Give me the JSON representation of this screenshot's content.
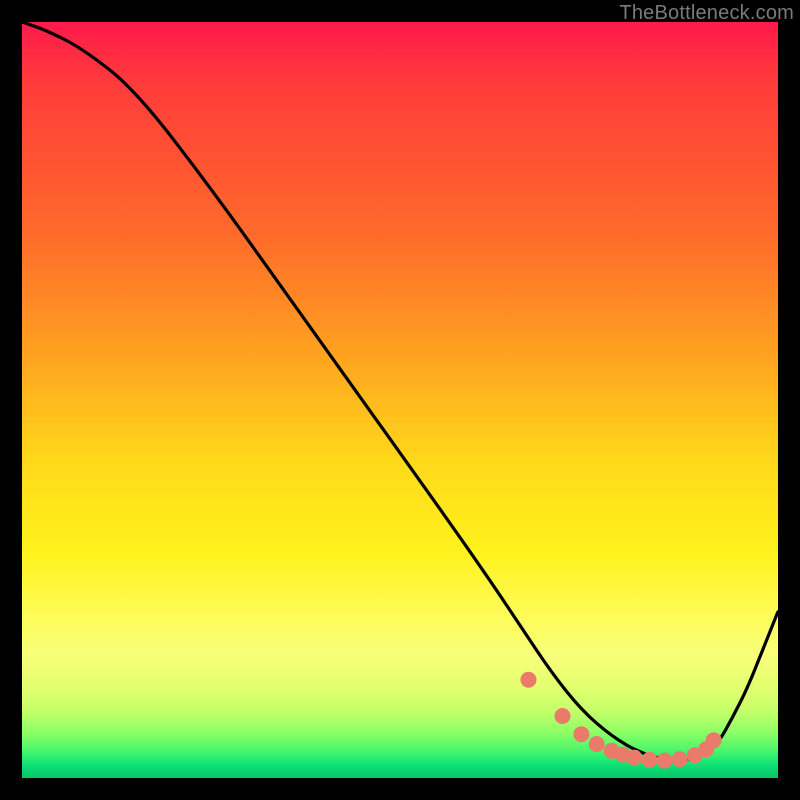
{
  "watermark": "TheBottleneck.com",
  "chart_data": {
    "type": "line",
    "title": "",
    "xlabel": "",
    "ylabel": "",
    "xlim": [
      0,
      100
    ],
    "ylim": [
      0,
      100
    ],
    "series": [
      {
        "name": "curve",
        "x": [
          0,
          3,
          8,
          15,
          25,
          35,
          45,
          55,
          62,
          66,
          70,
          74,
          78,
          82,
          86,
          90,
          92,
          94,
          96,
          98,
          100
        ],
        "y": [
          100,
          99,
          96.5,
          91,
          78,
          64,
          50,
          36,
          26,
          20,
          14,
          9,
          5.5,
          3.2,
          2.2,
          2.8,
          4.5,
          8,
          12,
          17,
          22
        ]
      }
    ],
    "markers": {
      "name": "dots",
      "color": "#ea7a6a",
      "x": [
        67,
        71.5,
        74,
        76,
        78,
        79.5,
        81,
        83,
        85,
        87,
        89,
        90.5,
        91.5
      ],
      "y": [
        13,
        8.2,
        5.8,
        4.5,
        3.6,
        3.1,
        2.7,
        2.4,
        2.3,
        2.5,
        3.0,
        3.8,
        5.0
      ]
    }
  },
  "colors": {
    "curve": "#000000",
    "marker": "#ea7a6a"
  }
}
